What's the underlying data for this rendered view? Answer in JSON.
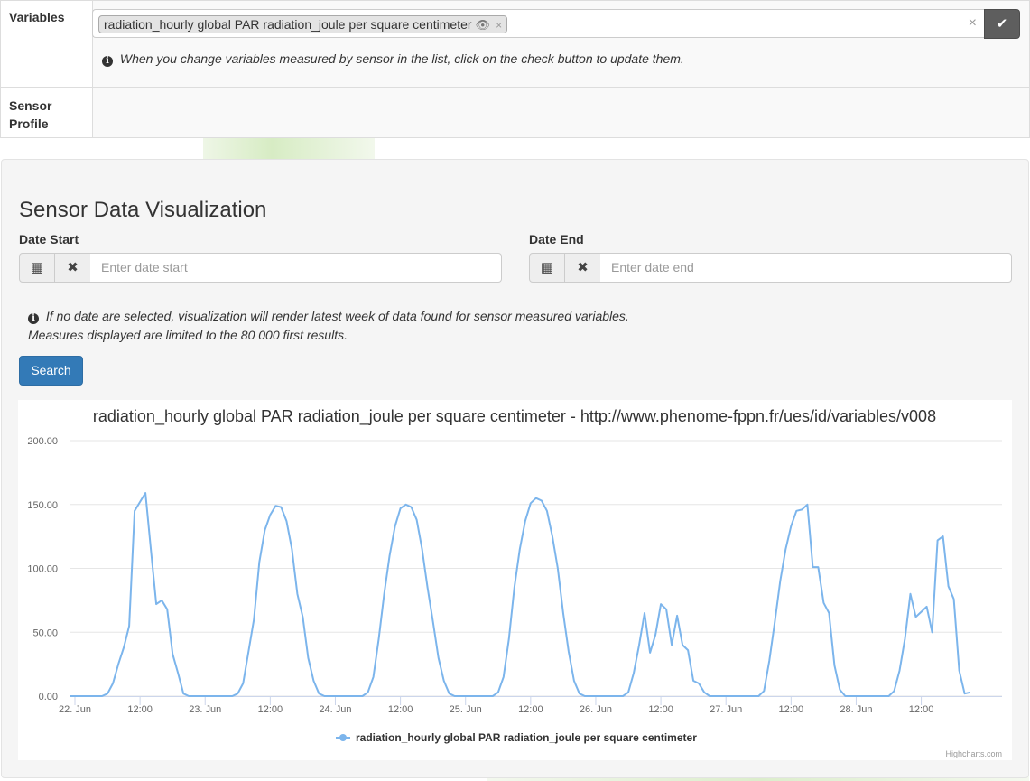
{
  "details": {
    "variables_label": "Variables",
    "selected_variable": "radiation_hourly global PAR radiation_joule per square centimeter",
    "tag_remove": "×",
    "clear_all": "×",
    "help_text": "When you change variables measured by sensor in the list, click on the check button to update them.",
    "sensor_profile_label": "Sensor Profile"
  },
  "visualization": {
    "title": "Sensor Data Visualization",
    "date_start_label": "Date Start",
    "date_start_placeholder": "Enter date start",
    "date_end_label": "Date End",
    "date_end_placeholder": "Enter date end",
    "note_line1": "If no date are selected, visualization will render latest week of data found for sensor measured variables.",
    "note_line2": "Measures displayed are limited to the 80 000 first results.",
    "search_label": "Search"
  },
  "icons": {
    "eye": "eye-icon",
    "check": "check-icon",
    "calendar": "calendar-icon",
    "remove": "remove-icon",
    "info": "info-circle-icon"
  },
  "colors": {
    "series": "#7cb5ec",
    "primary_button": "#337ab7",
    "check_button": "#5e5e5e"
  },
  "chart_data": {
    "type": "line",
    "title": "radiation_hourly global PAR radiation_joule per square centimeter - http://www.phenome-fppn.fr/ues/id/variables/v008",
    "credits": "Highcharts.com",
    "y_ticks": [
      "0.00",
      "50.00",
      "100.00",
      "150.00",
      "200.00"
    ],
    "ylim": [
      0,
      200
    ],
    "x_ticks": [
      {
        "label": "22. Jun",
        "h": 0
      },
      {
        "label": "12:00",
        "h": 12
      },
      {
        "label": "23. Jun",
        "h": 24
      },
      {
        "label": "12:00",
        "h": 36
      },
      {
        "label": "24. Jun",
        "h": 48
      },
      {
        "label": "12:00",
        "h": 60
      },
      {
        "label": "25. Jun",
        "h": 72
      },
      {
        "label": "12:00",
        "h": 84
      },
      {
        "label": "26. Jun",
        "h": 96
      },
      {
        "label": "12:00",
        "h": 108
      },
      {
        "label": "27. Jun",
        "h": 120
      },
      {
        "label": "12:00",
        "h": 132
      },
      {
        "label": "28. Jun",
        "h": 144
      },
      {
        "label": "12:00",
        "h": 156
      }
    ],
    "xlim_hours": [
      -1,
      166
    ],
    "legend_position": "bottom-center",
    "series": [
      {
        "name": "radiation_hourly global PAR radiation_joule per square centimeter",
        "points": [
          [
            -1,
            0
          ],
          [
            0,
            0
          ],
          [
            1,
            0
          ],
          [
            2,
            0
          ],
          [
            3,
            0
          ],
          [
            4,
            0
          ],
          [
            5,
            0
          ],
          [
            6,
            2
          ],
          [
            7,
            10
          ],
          [
            8,
            25
          ],
          [
            9,
            38
          ],
          [
            10,
            55
          ],
          [
            11,
            145
          ],
          [
            12,
            152
          ],
          [
            13,
            159
          ],
          [
            14,
            115
          ],
          [
            15,
            72
          ],
          [
            16,
            75
          ],
          [
            17,
            68
          ],
          [
            18,
            33
          ],
          [
            19,
            18
          ],
          [
            20,
            2
          ],
          [
            21,
            0
          ],
          [
            22,
            0
          ],
          [
            23,
            0
          ],
          [
            24,
            0
          ],
          [
            25,
            0
          ],
          [
            26,
            0
          ],
          [
            27,
            0
          ],
          [
            28,
            0
          ],
          [
            29,
            0
          ],
          [
            30,
            2
          ],
          [
            31,
            10
          ],
          [
            32,
            35
          ],
          [
            33,
            60
          ],
          [
            34,
            105
          ],
          [
            35,
            130
          ],
          [
            36,
            142
          ],
          [
            37,
            149
          ],
          [
            38,
            148
          ],
          [
            39,
            137
          ],
          [
            40,
            115
          ],
          [
            41,
            80
          ],
          [
            42,
            62
          ],
          [
            43,
            30
          ],
          [
            44,
            12
          ],
          [
            45,
            2
          ],
          [
            46,
            0
          ],
          [
            47,
            0
          ],
          [
            48,
            0
          ],
          [
            49,
            0
          ],
          [
            50,
            0
          ],
          [
            51,
            0
          ],
          [
            52,
            0
          ],
          [
            53,
            0
          ],
          [
            54,
            3
          ],
          [
            55,
            15
          ],
          [
            56,
            45
          ],
          [
            57,
            80
          ],
          [
            58,
            110
          ],
          [
            59,
            133
          ],
          [
            60,
            147
          ],
          [
            61,
            150
          ],
          [
            62,
            148
          ],
          [
            63,
            138
          ],
          [
            64,
            115
          ],
          [
            65,
            85
          ],
          [
            66,
            58
          ],
          [
            67,
            30
          ],
          [
            68,
            12
          ],
          [
            69,
            2
          ],
          [
            70,
            0
          ],
          [
            71,
            0
          ],
          [
            72,
            0
          ],
          [
            73,
            0
          ],
          [
            74,
            0
          ],
          [
            75,
            0
          ],
          [
            76,
            0
          ],
          [
            77,
            0
          ],
          [
            78,
            3
          ],
          [
            79,
            15
          ],
          [
            80,
            45
          ],
          [
            81,
            85
          ],
          [
            82,
            115
          ],
          [
            83,
            137
          ],
          [
            84,
            151
          ],
          [
            85,
            155
          ],
          [
            86,
            153
          ],
          [
            87,
            145
          ],
          [
            88,
            125
          ],
          [
            89,
            100
          ],
          [
            90,
            65
          ],
          [
            91,
            35
          ],
          [
            92,
            12
          ],
          [
            93,
            2
          ],
          [
            94,
            0
          ],
          [
            95,
            0
          ],
          [
            96,
            0
          ],
          [
            97,
            0
          ],
          [
            98,
            0
          ],
          [
            99,
            0
          ],
          [
            100,
            0
          ],
          [
            101,
            0
          ],
          [
            102,
            3
          ],
          [
            103,
            18
          ],
          [
            104,
            40
          ],
          [
            105,
            65
          ],
          [
            106,
            34
          ],
          [
            107,
            48
          ],
          [
            108,
            72
          ],
          [
            109,
            68
          ],
          [
            110,
            40
          ],
          [
            111,
            63
          ],
          [
            112,
            40
          ],
          [
            113,
            36
          ],
          [
            114,
            12
          ],
          [
            115,
            10
          ],
          [
            116,
            3
          ],
          [
            117,
            0
          ],
          [
            118,
            0
          ],
          [
            119,
            0
          ],
          [
            120,
            0
          ],
          [
            121,
            0
          ],
          [
            122,
            0
          ],
          [
            123,
            0
          ],
          [
            124,
            0
          ],
          [
            125,
            0
          ],
          [
            126,
            0
          ],
          [
            127,
            4
          ],
          [
            128,
            28
          ],
          [
            129,
            58
          ],
          [
            130,
            90
          ],
          [
            131,
            115
          ],
          [
            132,
            133
          ],
          [
            133,
            145
          ],
          [
            134,
            146
          ],
          [
            135,
            150
          ],
          [
            136,
            101
          ],
          [
            137,
            101
          ],
          [
            138,
            73
          ],
          [
            139,
            65
          ],
          [
            140,
            24
          ],
          [
            141,
            5
          ],
          [
            142,
            0
          ],
          [
            143,
            0
          ],
          [
            144,
            0
          ],
          [
            145,
            0
          ],
          [
            146,
            0
          ],
          [
            147,
            0
          ],
          [
            148,
            0
          ],
          [
            149,
            0
          ],
          [
            150,
            0
          ],
          [
            151,
            4
          ],
          [
            152,
            20
          ],
          [
            153,
            45
          ],
          [
            154,
            80
          ],
          [
            155,
            62
          ],
          [
            156,
            66
          ],
          [
            157,
            70
          ],
          [
            158,
            50
          ],
          [
            159,
            122
          ],
          [
            160,
            125
          ],
          [
            161,
            86
          ],
          [
            162,
            76
          ],
          [
            163,
            20
          ],
          [
            164,
            2
          ],
          [
            165,
            3
          ]
        ]
      }
    ]
  }
}
